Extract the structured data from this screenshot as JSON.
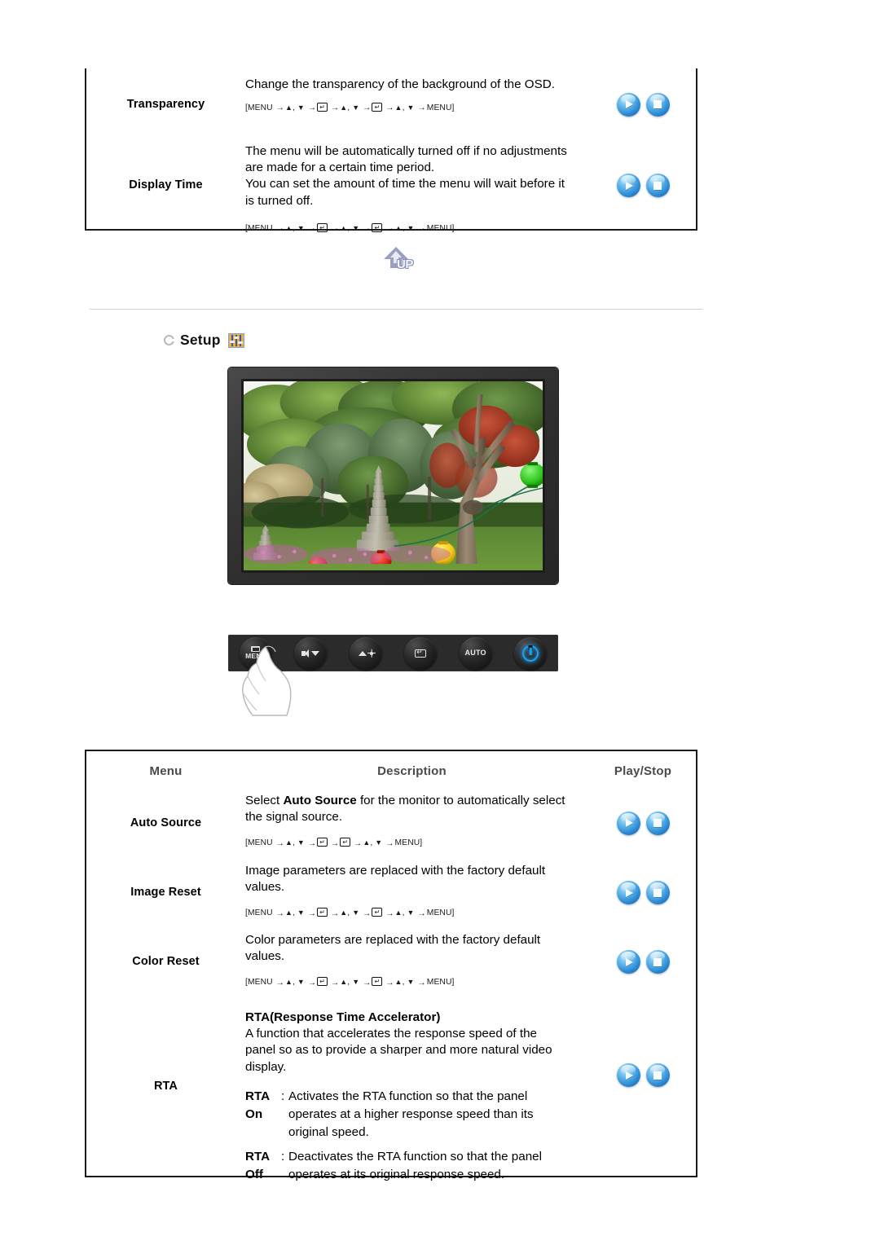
{
  "page": {
    "divider_color": "#d3d1cb"
  },
  "up_button": {
    "label": "UP",
    "icon": "up-arrow-icon"
  },
  "section": {
    "bullet": "circle-bullet-icon",
    "title": "Setup",
    "icon": "setup-sliders-icon"
  },
  "orb_icons": {
    "play": "play-icon",
    "stop": "stop-icon"
  },
  "nav_keys": {
    "menu": "MENU",
    "up": "▲",
    "down": "▼",
    "enter": "↵",
    "arrow": "→",
    "open": "[",
    "close": "]",
    "comma": ", "
  },
  "table_osd": {
    "rows": [
      {
        "menu": "Transparency",
        "desc_lines": [
          "Change the transparency of the background of the OSD."
        ],
        "nav": "[MENU → ▲, ▼ → ↵ → ▲, ▼ → ↵ → ▲, ▼ → MENU]",
        "nav_steps": [
          "MENU",
          "UPDN",
          "ENTER",
          "UPDN",
          "ENTER",
          "UPDN",
          "MENU"
        ]
      },
      {
        "menu": "Display Time",
        "desc_lines": [
          "The menu will be automatically turned off if no adjustments",
          "are made for a certain time period.",
          "You can set the amount of time the menu will wait before it",
          "is turned off."
        ],
        "nav": "[MENU → ▲, ▼ → ↵ → ▲, ▼ → ↵ → ▲, ▼ → MENU]",
        "nav_steps": [
          "MENU",
          "UPDN",
          "ENTER",
          "UPDN",
          "ENTER",
          "UPDN",
          "MENU"
        ]
      }
    ]
  },
  "monitor": {
    "name": "monitor-product-photo",
    "screen_caption": "Korean garden photo with stone pagoda, trees and paper lanterns"
  },
  "control_bar": {
    "buttons": [
      {
        "name": "menu-button",
        "label": "MENU",
        "icon": "menu-icon"
      },
      {
        "name": "down-volume-button",
        "label": "",
        "icon": "volume-down-icon"
      },
      {
        "name": "up-brightness-button",
        "label": "",
        "icon": "brightness-up-icon"
      },
      {
        "name": "enter-button",
        "label": "",
        "icon": "enter-icon"
      },
      {
        "name": "auto-button",
        "label": "AUTO",
        "icon": "auto-icon"
      },
      {
        "name": "power-button",
        "label": "",
        "icon": "power-icon"
      }
    ]
  },
  "table_setup": {
    "headers": {
      "menu": "Menu",
      "description": "Description",
      "playstop": "Play/Stop"
    },
    "rows": [
      {
        "menu": "Auto Source",
        "desc_pre": "Select ",
        "desc_bold": "Auto Source",
        "desc_post": " for the monitor to automatically select",
        "desc_line2": "the signal source.",
        "nav": "[MENU → ▲, ▼ → ↵ → ↵ → ▲, ▼ → MENU]",
        "nav_steps": [
          "MENU",
          "UPDN",
          "ENTER",
          "ENTER",
          "UPDN",
          "MENU"
        ]
      },
      {
        "menu": "Image Reset",
        "desc_lines": [
          "Image parameters are replaced with the factory default",
          "values."
        ],
        "nav": "[MENU → ▲, ▼ → ↵ → ▲, ▼ → ↵ → ▲, ▼ → MENU]",
        "nav_steps": [
          "MENU",
          "UPDN",
          "ENTER",
          "UPDN",
          "ENTER",
          "UPDN",
          "MENU"
        ]
      },
      {
        "menu": "Color Reset",
        "desc_lines": [
          "Color parameters are replaced with the factory default",
          "values."
        ],
        "nav": "[MENU → ▲, ▼ → ↵ → ▲, ▼ → ↵ → ▲, ▼ → MENU]",
        "nav_steps": [
          "MENU",
          "UPDN",
          "ENTER",
          "UPDN",
          "ENTER",
          "UPDN",
          "MENU"
        ]
      },
      {
        "menu": "RTA",
        "title": "RTA(Response Time Accelerator)",
        "desc_lines": [
          "A function that accelerates the response speed of the",
          "panel so as to provide a sharper and more natural video",
          "display."
        ],
        "options": [
          {
            "key_line1": "RTA",
            "key_line2": "On",
            "colon": ":",
            "val_line1": "Activates the RTA function so that the panel",
            "val_line2": "operates at a higher response speed than its",
            "val_line3": "original speed."
          },
          {
            "key_line1": "RTA",
            "key_line2": "Off",
            "colon": ":",
            "val_line1": "Deactivates the RTA function so that the panel",
            "val_line2": "operates at its original response speed.",
            "val_line3": ""
          }
        ]
      }
    ]
  }
}
